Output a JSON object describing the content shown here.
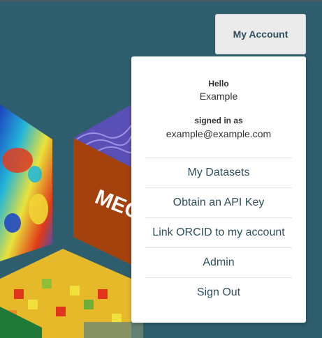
{
  "header": {
    "account_button_label": "My Account"
  },
  "account_menu": {
    "hello_label": "Hello",
    "user_name": "Example",
    "signed_in_label": "signed in as",
    "user_email": "example@example.com",
    "items": [
      {
        "label": "My Datasets"
      },
      {
        "label": "Obtain an API Key"
      },
      {
        "label": "Link ORCID to my account"
      },
      {
        "label": "Admin"
      },
      {
        "label": "Sign Out"
      }
    ]
  },
  "background": {
    "banner_text": "MEG"
  },
  "colors": {
    "page_background": "#2e5e6e",
    "button_background": "#ebebeb",
    "text_accent": "#2e4f5c",
    "cube_orange": "#a4410d"
  }
}
